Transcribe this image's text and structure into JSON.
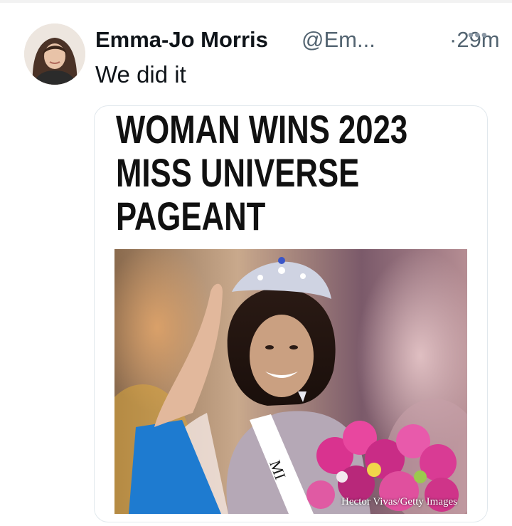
{
  "tweet": {
    "author_name": "Emma-Jo Morris",
    "handle": "@Em...",
    "separator": "·",
    "time": "29m",
    "more_icon": "more-icon",
    "text": "We did it"
  },
  "card": {
    "headline_lines": [
      "WOMAN WINS 2023",
      "MISS UNIVERSE",
      "PAGEANT"
    ],
    "photo_credit": "Hector Vivas/Getty Images",
    "sash_text": "MI"
  }
}
